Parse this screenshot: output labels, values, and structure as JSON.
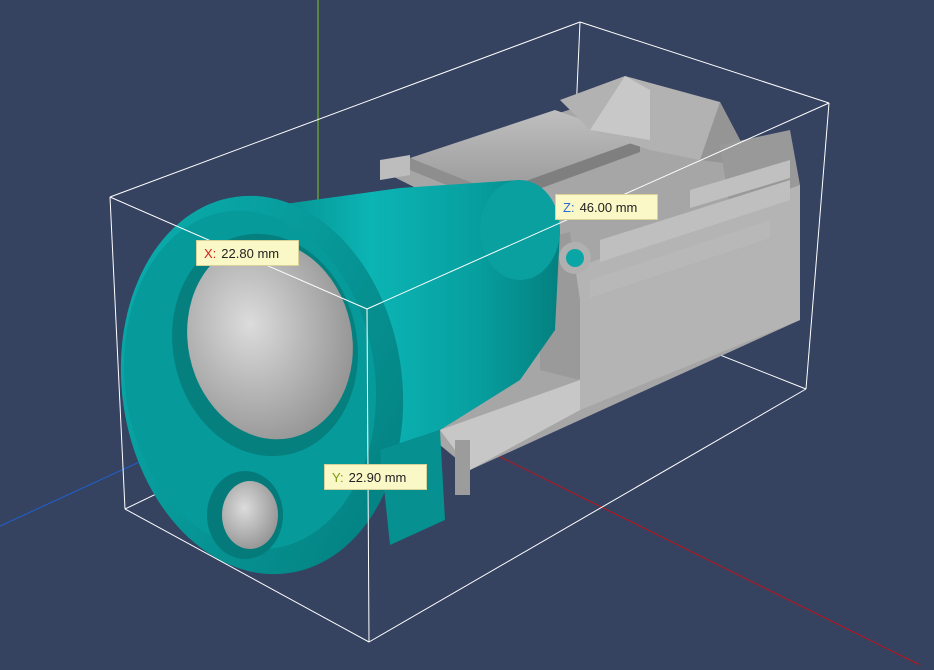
{
  "colors": {
    "background": "#354260",
    "x_axis": "#c01418",
    "y_axis": "#80c820",
    "z_axis": "#2060d0",
    "part_teal": "#0aa6a6",
    "part_gray": "#a9a9a9",
    "bounding_box": "#ffffff",
    "label_background": "#fbf8c8"
  },
  "dimensions": {
    "x": {
      "axis": "X:",
      "value": "22.80 mm",
      "axis_color": "#d42020"
    },
    "y": {
      "axis": "Y:",
      "value": "22.90 mm",
      "axis_color": "#7a9a10"
    },
    "z": {
      "axis": "Z:",
      "value": "46.00 mm",
      "axis_color": "#2a6ad6"
    }
  }
}
